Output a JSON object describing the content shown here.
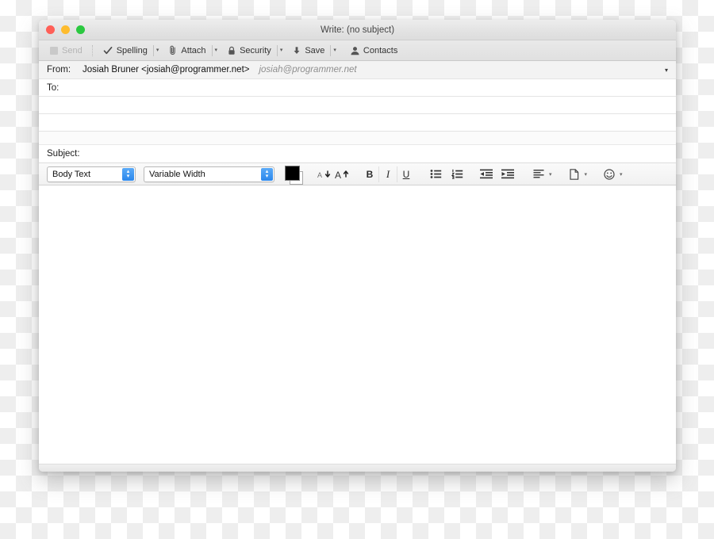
{
  "window": {
    "title": "Write: (no subject)",
    "traffic_lights": [
      {
        "name": "close",
        "color": "#ff5f57"
      },
      {
        "name": "minimize",
        "color": "#febc2e"
      },
      {
        "name": "zoom",
        "color": "#2bc840"
      }
    ]
  },
  "toolbar": {
    "send_label": "Send",
    "spelling_label": "Spelling",
    "attach_label": "Attach",
    "security_label": "Security",
    "save_label": "Save",
    "contacts_label": "Contacts",
    "caret_glyph": "▾"
  },
  "fields": {
    "from_label": "From:",
    "from_value": "Josiah Bruner <josiah@programmer.net>",
    "from_alias": "josiah@programmer.net",
    "from_caret_glyph": "▾",
    "to_label": "To:",
    "to_value": "",
    "recipient_row_2": "",
    "recipient_row_3": "",
    "subject_label": "Subject:",
    "subject_value": ""
  },
  "formatbar": {
    "paragraph_style": "Body Text",
    "font_family": "Variable Width",
    "stepper_up_glyph": "▴",
    "stepper_down_glyph": "▾",
    "foreground_color": "#000000",
    "background_color": "#ffffff",
    "decrease_size_label": "A",
    "increase_size_label": "A",
    "bold_label": "B",
    "italic_label": "I",
    "underline_label": "U",
    "bullet_list_label": "Bulleted List",
    "numbered_list_label": "Numbered List",
    "outdent_label": "Decrease Indent",
    "indent_label": "Increase Indent",
    "align_label": "Align",
    "insert_label": "Insert",
    "smiley_label": "Insert Smiley",
    "caret_glyph": "▾"
  },
  "body": {
    "content": ""
  }
}
